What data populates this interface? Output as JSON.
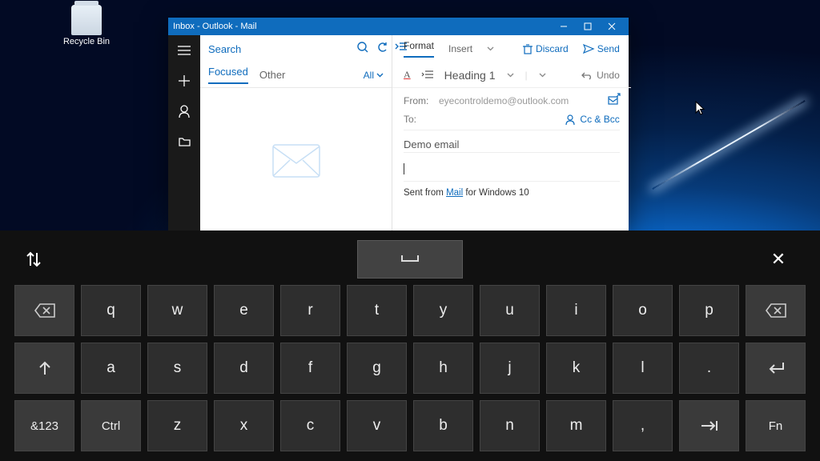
{
  "desktop": {
    "recycle_label": "Recycle Bin"
  },
  "window": {
    "title": "Inbox - Outlook - Mail",
    "search_placeholder": "Search",
    "tabs": {
      "focused": "Focused",
      "other": "Other",
      "all": "All"
    },
    "cmd": {
      "format": "Format",
      "insert": "Insert",
      "discard": "Discard",
      "send": "Send"
    },
    "fmt": {
      "heading": "Heading 1",
      "undo": "Undo"
    },
    "from_label": "From:",
    "from_value": "eyecontroldemo@outlook.com",
    "to_label": "To:",
    "ccbcc": "Cc & Bcc",
    "subject": "Demo email",
    "sig_prefix": "Sent from ",
    "sig_link": "Mail",
    "sig_suffix": " for Windows 10"
  },
  "keyboard": {
    "row1": [
      "q",
      "w",
      "e",
      "r",
      "t",
      "y",
      "u",
      "i",
      "o",
      "p"
    ],
    "row2": [
      "a",
      "s",
      "d",
      "f",
      "g",
      "h",
      "j",
      "k",
      "l",
      "."
    ],
    "row3": [
      "&123",
      "Ctrl",
      "z",
      "x",
      "c",
      "v",
      "b",
      "n",
      "m",
      ","
    ],
    "fn": "Fn"
  }
}
